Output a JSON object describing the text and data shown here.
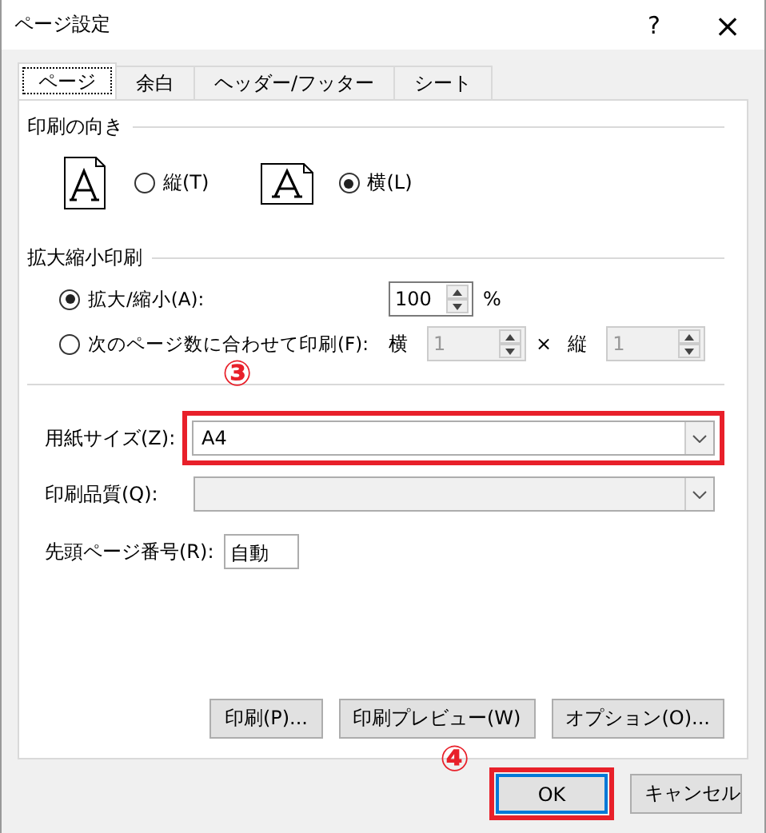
{
  "window": {
    "title": "ページ設定",
    "help_button": "?",
    "close_button": "×"
  },
  "tabs": [
    {
      "label": "ページ",
      "selected": true
    },
    {
      "label": "余白",
      "selected": false
    },
    {
      "label": "ヘッダー/フッター",
      "selected": false
    },
    {
      "label": "シート",
      "selected": false
    }
  ],
  "orientation": {
    "heading": "印刷の向き",
    "options": [
      {
        "kind": "portrait",
        "label": "縦(T)",
        "selected": false
      },
      {
        "kind": "landscape",
        "label": "横(L)",
        "selected": true
      }
    ]
  },
  "scaling": {
    "heading": "拡大縮小印刷",
    "options": [
      {
        "kind": "adjust",
        "label": "拡大/縮小(A):",
        "selected": true,
        "value": "100",
        "unit": "%"
      },
      {
        "kind": "fit",
        "label": "次のページ数に合わせて印刷(F):",
        "selected": false,
        "disabled": true,
        "wide_label": "横",
        "wide_value": "1",
        "times": "×",
        "tall_label": "縦",
        "tall_value": "1"
      }
    ]
  },
  "paper_size": {
    "label": "用紙サイズ(Z):",
    "value": "A4",
    "highlighted": true,
    "marker": "③"
  },
  "print_quality": {
    "label": "印刷品質(Q):",
    "disabled": true
  },
  "first_page_number": {
    "label": "先頭ページ番号(R):",
    "value": "自動"
  },
  "panel_buttons": [
    "印刷(P)...",
    "印刷プレビュー(W)",
    "オプション(O)..."
  ],
  "buttons": [
    {
      "label": "OK",
      "default": true,
      "highlighted": true,
      "marker": "④"
    },
    {
      "label": "キャンセル",
      "default": false,
      "highlighted": false
    }
  ]
}
